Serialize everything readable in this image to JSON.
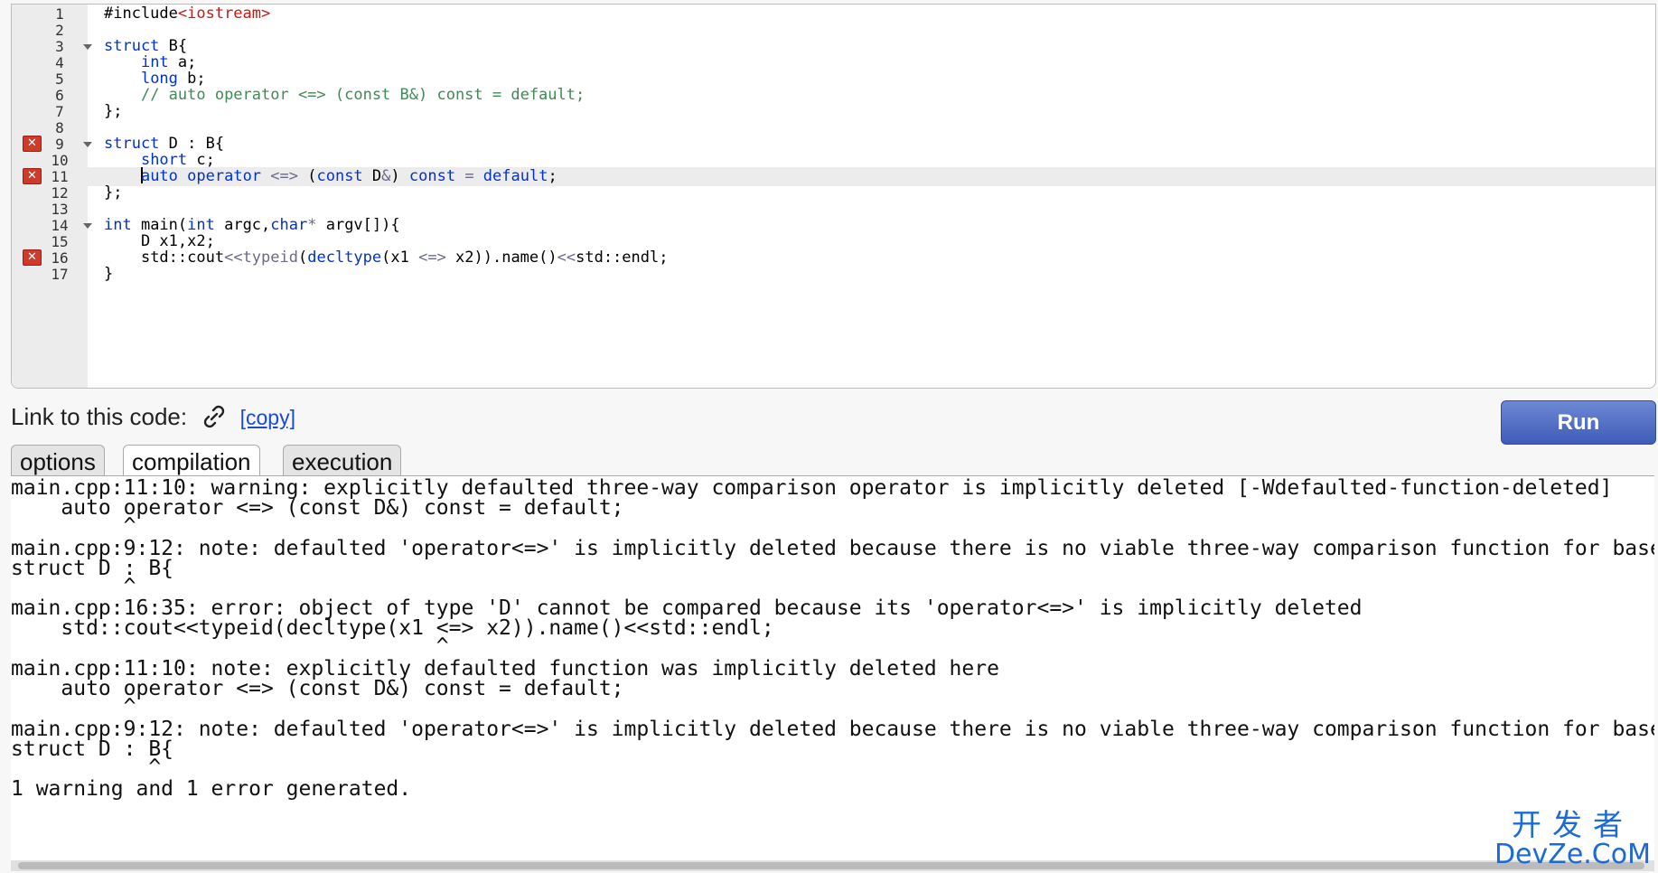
{
  "editor": {
    "lines": [
      {
        "n": "1",
        "err": false,
        "fold": false
      },
      {
        "n": "2",
        "err": false,
        "fold": false
      },
      {
        "n": "3",
        "err": false,
        "fold": true
      },
      {
        "n": "4",
        "err": false,
        "fold": false
      },
      {
        "n": "5",
        "err": false,
        "fold": false
      },
      {
        "n": "6",
        "err": false,
        "fold": false
      },
      {
        "n": "7",
        "err": false,
        "fold": false
      },
      {
        "n": "8",
        "err": false,
        "fold": false
      },
      {
        "n": "9",
        "err": true,
        "fold": true
      },
      {
        "n": "10",
        "err": false,
        "fold": false
      },
      {
        "n": "11",
        "err": true,
        "fold": false,
        "active": true
      },
      {
        "n": "12",
        "err": false,
        "fold": false
      },
      {
        "n": "13",
        "err": false,
        "fold": false
      },
      {
        "n": "14",
        "err": false,
        "fold": true
      },
      {
        "n": "15",
        "err": false,
        "fold": false
      },
      {
        "n": "16",
        "err": true,
        "fold": false
      },
      {
        "n": "17",
        "err": false,
        "fold": false
      }
    ],
    "code": {
      "l1a": "#include",
      "l1b": "<iostream>",
      "l3a": "struct",
      "l3b": " B{",
      "l4a": "int",
      "l4b": " a;",
      "l5a": "long",
      "l5b": " b;",
      "l6": "// auto operator <=> (const B&) const = default;",
      "l7": "};",
      "l9a": "struct",
      "l9b": " D : B{",
      "l10a": "short",
      "l10b": " c;",
      "l11a": "auto",
      "l11b": " ",
      "l11c": "operator",
      "l11d": " <=> ",
      "l11e": "(",
      "l11f": "const",
      "l11g": " D",
      "l11h": "&",
      ") ": "",
      "l11i": ") ",
      "l11j": "const",
      "l11k": " = ",
      "l11l": "default",
      ";": "",
      "l11m": ";",
      "l12": "};",
      "l14a": "int",
      "l14b": " main(",
      "l14c": "int",
      "l14d": " argc,",
      "l14e": "char",
      "l14f": "*",
      "l14g": " argv[]){",
      "l15": "D x1,x2;",
      "l16a": "std::cout",
      "l16b": "<<",
      "l16c": "typeid",
      "l16d": "(",
      "l16e": "decltype",
      "l16f": "(x1 ",
      "l16g": "<=>",
      "l16h": " x2)).name()",
      "l16i": "<<",
      "l16j": "std::endl;",
      "l17": "}"
    },
    "error_icon": "x-icon"
  },
  "link": {
    "label": "Link to this code:",
    "copy": "[copy]",
    "icon": "chain-link-icon"
  },
  "run_label": "Run",
  "tabs": [
    "options",
    "compilation",
    "execution"
  ],
  "active_tab": "compilation",
  "output": [
    "main.cpp:11:10: warning: explicitly defaulted three-way comparison operator is implicitly deleted [-Wdefaulted-function-deleted]",
    "    auto operator <=> (const D&) const = default;",
    "         ^",
    "main.cpp:9:12: note: defaulted 'operator<=>' is implicitly deleted because there is no viable three-way comparison function for base",
    "struct D : B{",
    "         ^",
    "main.cpp:16:35: error: object of type 'D' cannot be compared because its 'operator<=>' is implicitly deleted",
    "    std::cout<<typeid(decltype(x1 <=> x2)).name()<<std::endl;",
    "                                  ^",
    "main.cpp:11:10: note: explicitly defaulted function was implicitly deleted here",
    "    auto operator <=> (const D&) const = default;",
    "         ^",
    "main.cpp:9:12: note: defaulted 'operator<=>' is implicitly deleted because there is no viable three-way comparison function for base",
    "struct D : B{",
    "           ^",
    "1 warning and 1 error generated."
  ],
  "watermark": {
    "line1": "开发者",
    "line2": "DevZe.CoM"
  }
}
